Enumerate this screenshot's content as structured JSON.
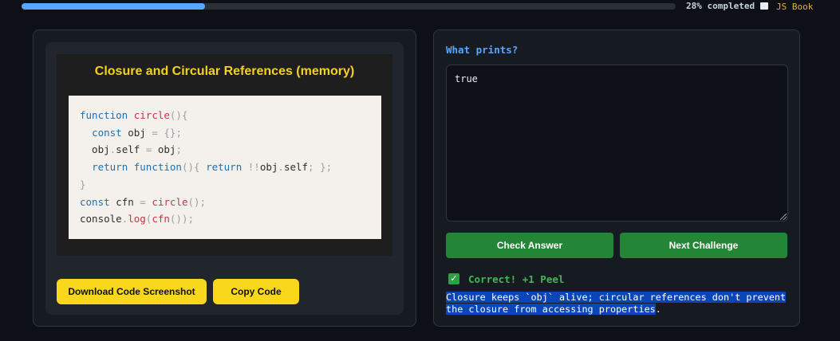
{
  "progress": {
    "percent": 28,
    "text": "28% completed"
  },
  "book": {
    "icon": "book-icon",
    "label": "JS Book"
  },
  "challenge": {
    "title": "Closure and Circular References (memory)",
    "code_lines": [
      [
        {
          "t": "function",
          "c": "kw"
        },
        {
          "t": " "
        },
        {
          "t": "circle",
          "c": "fn"
        },
        {
          "t": "(){",
          "c": "pu"
        }
      ],
      [
        {
          "t": "  "
        },
        {
          "t": "const",
          "c": "kw"
        },
        {
          "t": " obj "
        },
        {
          "t": "=",
          "c": "pu"
        },
        {
          "t": " "
        },
        {
          "t": "{};",
          "c": "pu"
        }
      ],
      [
        {
          "t": "  obj"
        },
        {
          "t": ".",
          "c": "pu"
        },
        {
          "t": "self "
        },
        {
          "t": "=",
          "c": "pu"
        },
        {
          "t": " obj"
        },
        {
          "t": ";",
          "c": "pu"
        }
      ],
      [
        {
          "t": "  "
        },
        {
          "t": "return",
          "c": "kw"
        },
        {
          "t": " "
        },
        {
          "t": "function",
          "c": "kw"
        },
        {
          "t": "(){ ",
          "c": "pu"
        },
        {
          "t": "return",
          "c": "kw"
        },
        {
          "t": " "
        },
        {
          "t": "!!",
          "c": "pu"
        },
        {
          "t": "obj"
        },
        {
          "t": ".",
          "c": "pu"
        },
        {
          "t": "self"
        },
        {
          "t": "; };",
          "c": "pu"
        }
      ],
      [
        {
          "t": "}",
          "c": "pu"
        }
      ],
      [
        {
          "t": "const",
          "c": "kw"
        },
        {
          "t": " cfn "
        },
        {
          "t": "=",
          "c": "pu"
        },
        {
          "t": " "
        },
        {
          "t": "circle",
          "c": "fn"
        },
        {
          "t": "();",
          "c": "pu"
        }
      ],
      [
        {
          "t": "console"
        },
        {
          "t": ".",
          "c": "pu"
        },
        {
          "t": "log",
          "c": "fn"
        },
        {
          "t": "(",
          "c": "pu"
        },
        {
          "t": "cfn",
          "c": "fn"
        },
        {
          "t": "());",
          "c": "pu"
        }
      ]
    ],
    "download_label": "Download Code Screenshot",
    "copy_label": "Copy Code"
  },
  "answer": {
    "prompt": "What prints?",
    "value": "true",
    "check_label": "Check Answer",
    "next_label": "Next Challenge"
  },
  "result": {
    "icon": "check-icon",
    "text": "Correct! +1 Peel",
    "explanation": "Closure keeps `obj` alive; circular references don't prevent the closure from accessing properties",
    "explanation_end": "."
  },
  "colors": {
    "accent": "#58a6ff",
    "success": "#238636",
    "highlight": "#f9d71c",
    "title": "#f5d21f"
  }
}
